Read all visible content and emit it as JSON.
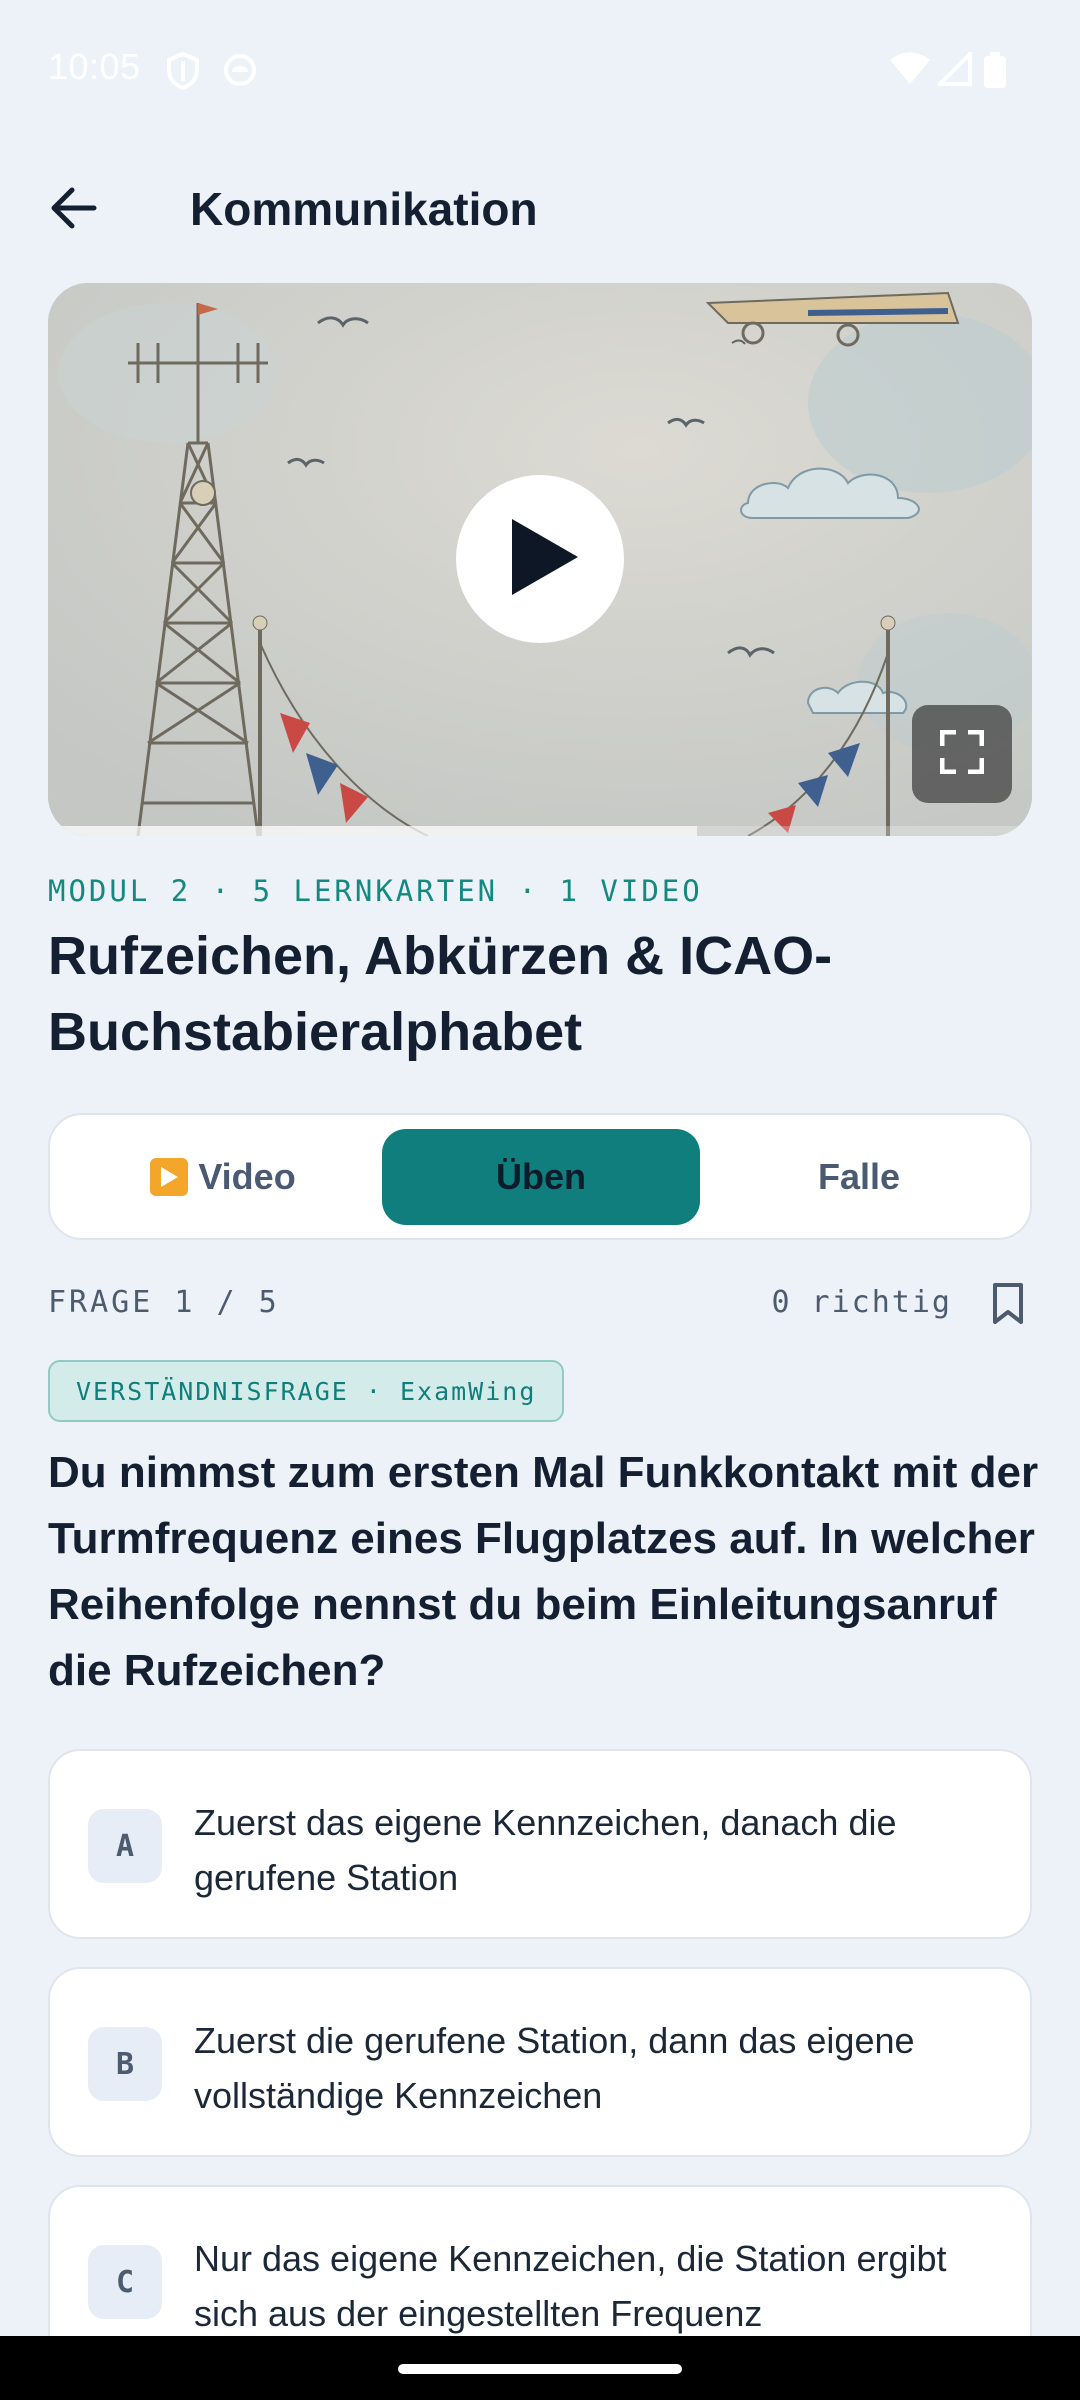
{
  "status_bar": {
    "time": "10:05",
    "icons": [
      "shield-icon",
      "sync-icon",
      "wifi-icon",
      "signal-icon",
      "battery-icon"
    ]
  },
  "app_bar": {
    "title": "Kommunikation",
    "back_icon": "arrow-left-icon"
  },
  "video": {
    "play_icon": "play-icon",
    "fullscreen_icon": "fullscreen-icon",
    "progress": 0.66
  },
  "lesson": {
    "meta": "MODUL 2 · 5 LERNKARTEN · 1 VIDEO",
    "title": "Rufzeichen, Abkürzen & ICAO-Buchstabieralphabet"
  },
  "tabs": [
    {
      "label": "Video",
      "icon": "play-button-emoji"
    },
    {
      "label": "Üben",
      "active": true
    },
    {
      "label": "Falle"
    }
  ],
  "quiz": {
    "counter": "FRAGE 1 / 5",
    "correct": "0 richtig",
    "badge": "VERSTÄNDNISFRAGE · ExamWing",
    "question": "Du nimmst zum ersten Mal Funkkontakt mit der Turmfrequenz eines Flugplatzes auf. In welcher Reihenfolge nennst du beim Einleitungsanruf die Rufzeichen?",
    "options": [
      {
        "letter": "A",
        "text": "Zuerst das eigene Kennzeichen, danach die gerufene Station"
      },
      {
        "letter": "B",
        "text": "Zuerst die gerufene Station, dann das eigene vollständige Kennzeichen"
      },
      {
        "letter": "C",
        "text": "Nur das eigene Kennzeichen, die Station ergibt sich aus der eingestellten Frequenz"
      }
    ]
  },
  "colors": {
    "background": "#edf2f8",
    "accent": "#0f7e7c",
    "title_text": "#142032"
  }
}
